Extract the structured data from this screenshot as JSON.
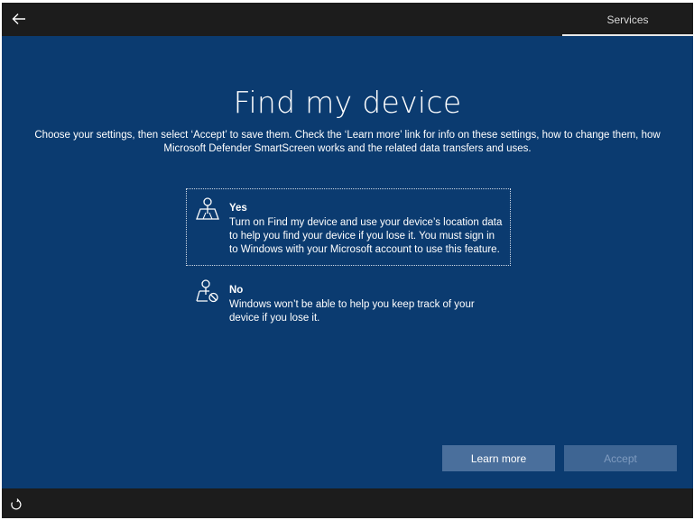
{
  "header": {
    "tab_label": "Services",
    "icons": {
      "back": "back-arrow-icon"
    }
  },
  "main": {
    "title": "Find my device",
    "subtitle": "Choose your settings, then select ‘Accept’ to save them. Check the ‘Learn more’ link for info on these settings, how to change them, how Microsoft Defender SmartScreen works and the related data transfers and uses.",
    "options": [
      {
        "title": "Yes",
        "description": "Turn on Find my device and use your device’s location data to help you find your device if you lose it. You must sign in to Windows with your Microsoft account to use this feature.",
        "icon": "location-map-icon",
        "selected": true
      },
      {
        "title": "No",
        "description": "Windows won’t be able to help you keep track of your device if you lose it.",
        "icon": "location-off-icon",
        "selected": false
      }
    ],
    "buttons": {
      "learn_more": "Learn more",
      "accept": "Accept"
    }
  },
  "footer": {
    "icons": {
      "accessibility": "accessibility-icon"
    }
  },
  "colors": {
    "background": "#0b3b70",
    "bars": "#1c1c1c",
    "learn_more_button": "#4a6f9c",
    "accept_button": "#3e6593"
  }
}
